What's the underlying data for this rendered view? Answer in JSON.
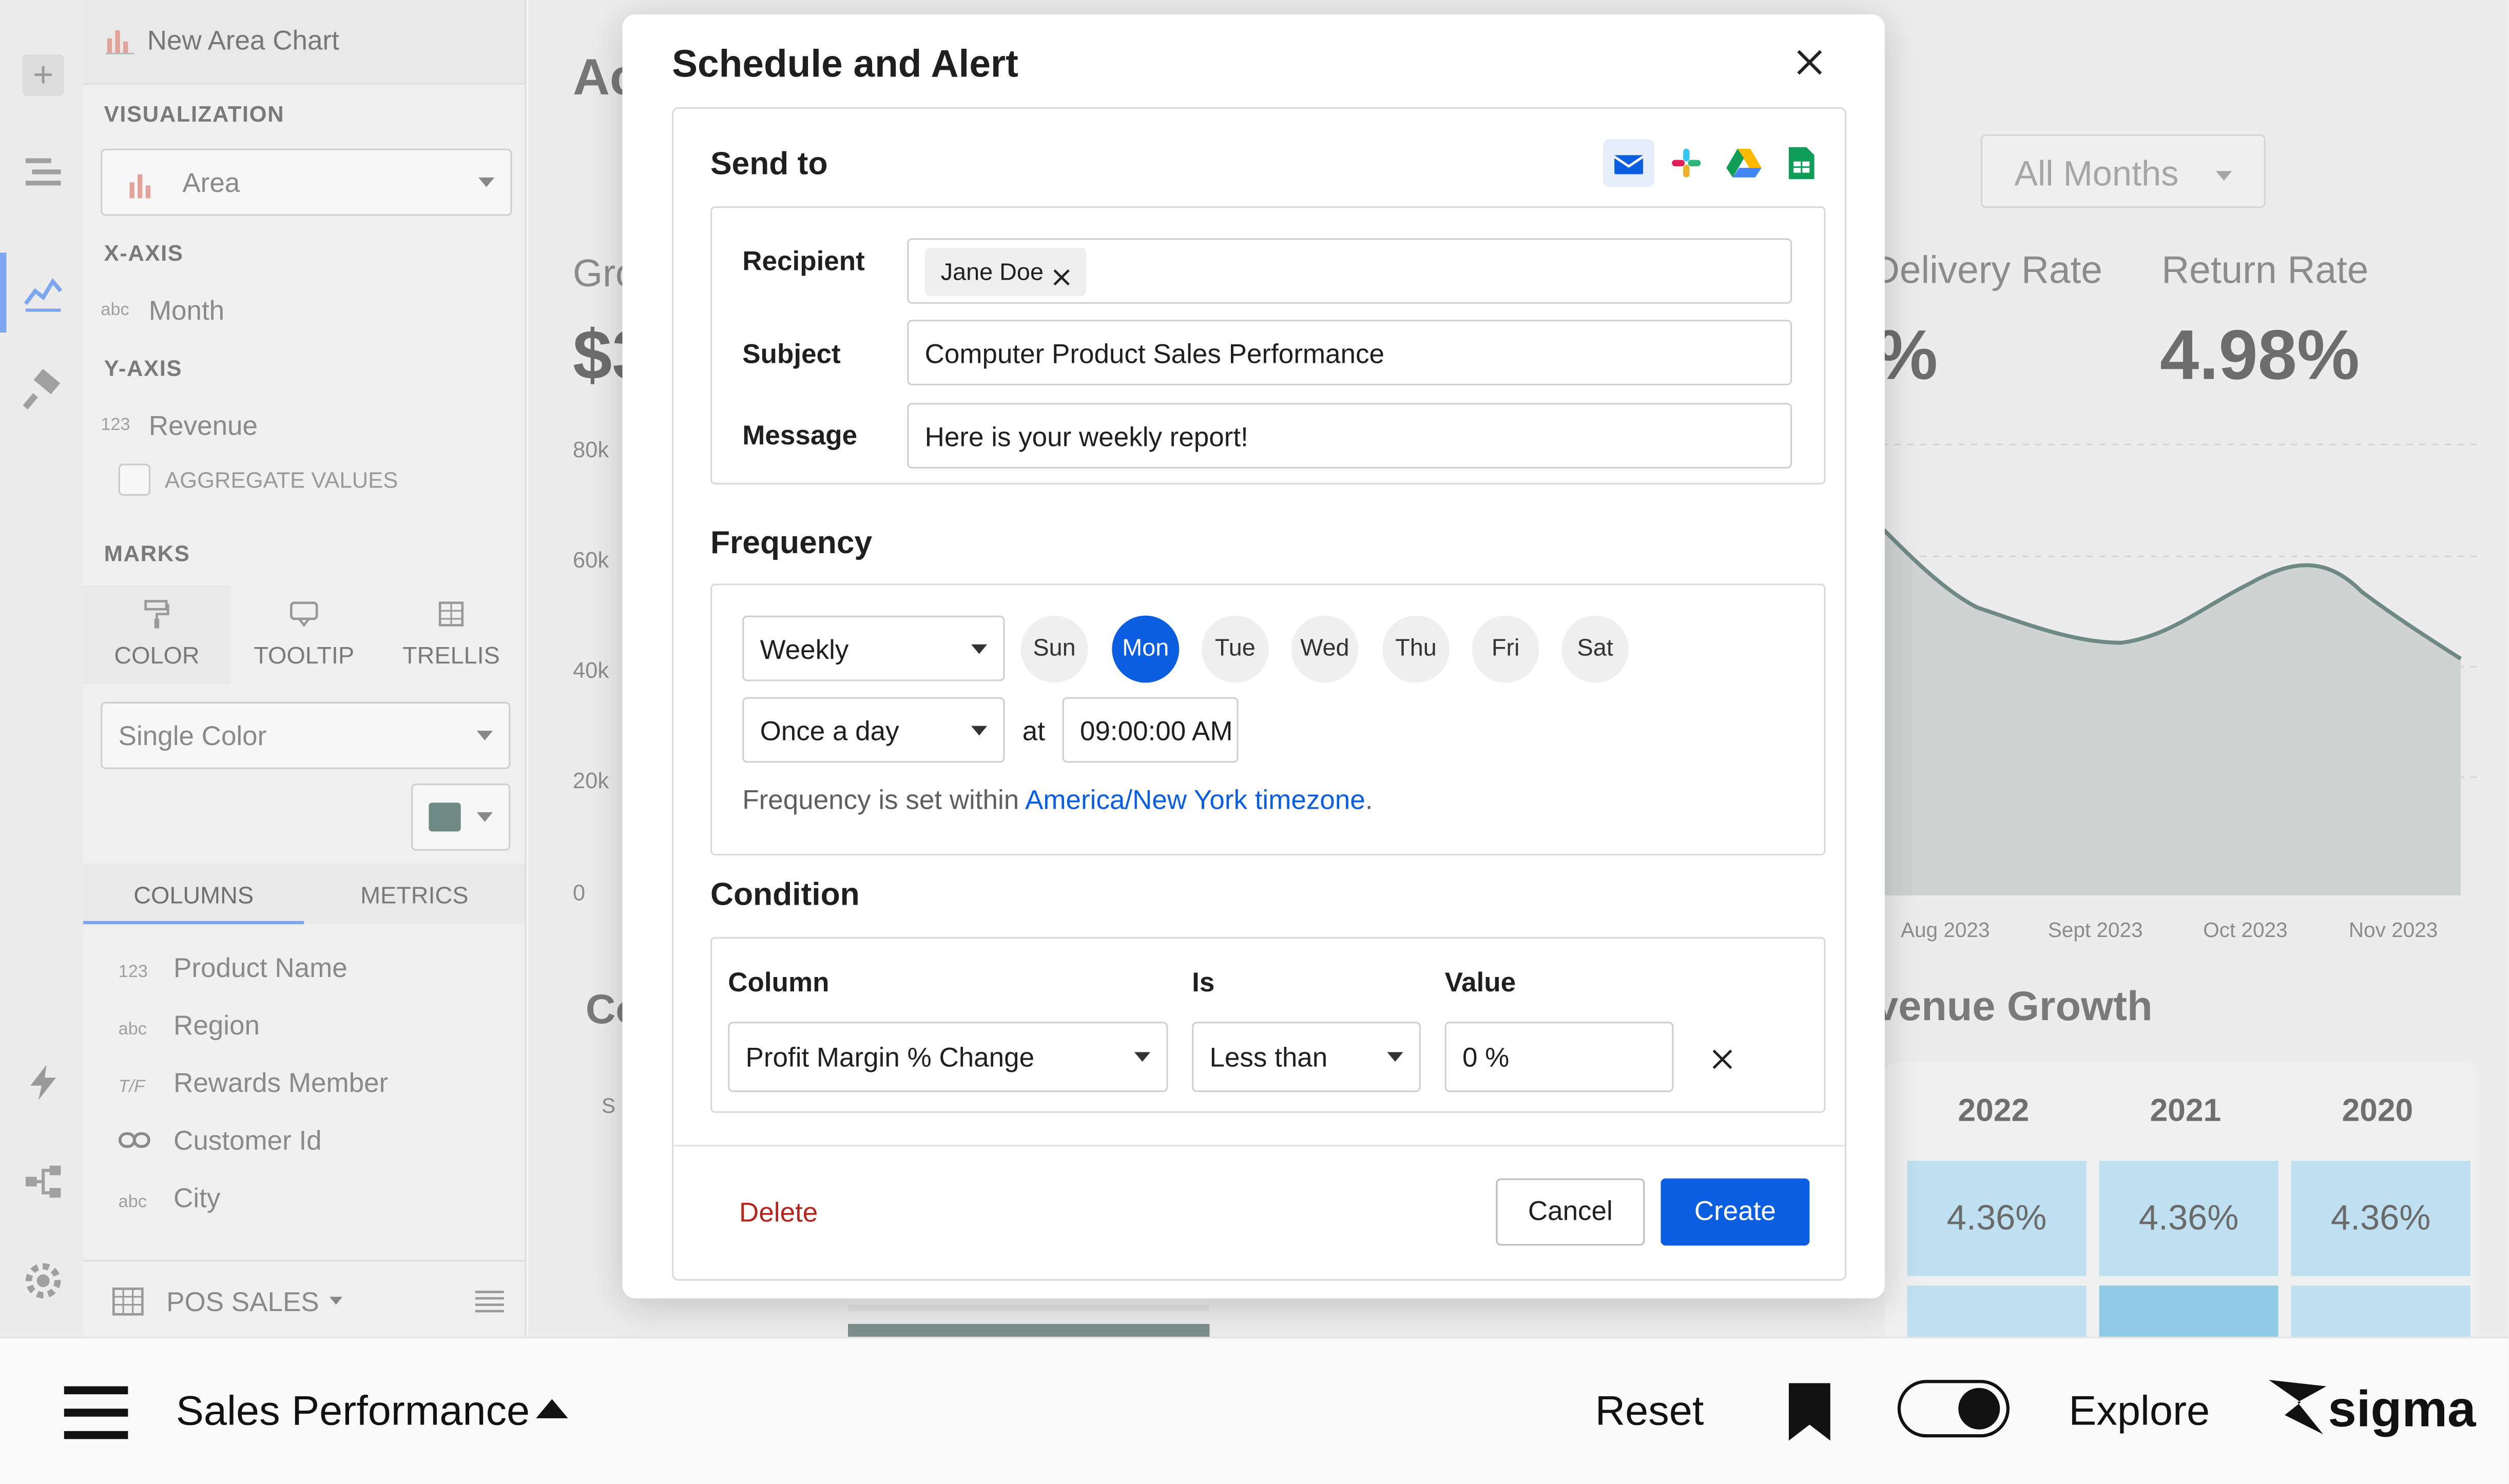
{
  "editor": {
    "chart_title": "New Area Chart",
    "visualization_label": "VISUALIZATION",
    "visualization_value": "Area",
    "x_axis_label": "X-AXIS",
    "x_axis_type": "abc",
    "x_axis_field": "Month",
    "y_axis_label": "Y-AXIS",
    "y_axis_type": "123",
    "y_axis_field": "Revenue",
    "aggregate_label": "AGGREGATE VALUES",
    "marks_label": "MARKS",
    "marks_tabs": [
      "COLOR",
      "TOOLTIP",
      "TRELLIS"
    ],
    "color_mode": "Single Color",
    "color_swatch": "#6f8a85",
    "tabs": [
      "COLUMNS",
      "METRICS"
    ],
    "columns": [
      {
        "type": "123",
        "name": "Product Name"
      },
      {
        "type": "abc",
        "name": "Region"
      },
      {
        "type": "T/F",
        "name": "Rewards Member"
      },
      {
        "type": "link",
        "name": "Customer Id"
      },
      {
        "type": "abc",
        "name": "City"
      }
    ],
    "source_label": "POS SALES"
  },
  "dashboard": {
    "title_partial": "Ac",
    "kpi_left_label_partial": "Gro",
    "kpi_left_value_partial": "$3",
    "filter_value": "All Months",
    "kpi_delivery_label": "Delivery Rate",
    "kpi_delivery_value_partial": "%",
    "kpi_return_label": "Return Rate",
    "kpi_return_value": "4.98%",
    "y_ticks": [
      "80k",
      "60k",
      "40k",
      "20k",
      "0"
    ],
    "x_ticks": [
      "Aug 2023",
      "Sept 2023",
      "Oct 2023",
      "Nov 2023"
    ],
    "section_left_partial": "Co",
    "section_right_partial": "venue Growth",
    "table_years": [
      "2022",
      "2021",
      "2020"
    ],
    "table_row1": [
      "4.36%",
      "4.36%",
      "4.36%"
    ],
    "row_label_partial": "S"
  },
  "modal": {
    "title": "Schedule and Alert",
    "send_to_label": "Send to",
    "recipient_label": "Recipient",
    "recipient_chip": "Jane Doe",
    "subject_label": "Subject",
    "subject_value": "Computer Product Sales Performance",
    "message_label": "Message",
    "message_value": "Here is your weekly report!",
    "frequency_label": "Frequency",
    "frequency_value": "Weekly",
    "days": [
      "Sun",
      "Mon",
      "Tue",
      "Wed",
      "Thu",
      "Fri",
      "Sat"
    ],
    "selected_day": "Mon",
    "repeat_value": "Once a day",
    "at_label": "at",
    "time_value": "09:00:00 AM",
    "timezone_prefix": "Frequency is set within ",
    "timezone_link": "America/New York timezone",
    "timezone_suffix": ".",
    "condition_label": "Condition",
    "col_header": "Column",
    "is_header": "Is",
    "value_header": "Value",
    "condition_column": "Profit Margin % Change",
    "condition_operator": "Less than",
    "condition_value": "0 %",
    "delete_label": "Delete",
    "cancel_label": "Cancel",
    "create_label": "Create",
    "accent": "#0b5ee0",
    "danger": "#b3261e"
  },
  "footer": {
    "workbook_title": "Sales Performance",
    "reset_label": "Reset",
    "explore_label": "Explore",
    "brand": "sigma"
  }
}
